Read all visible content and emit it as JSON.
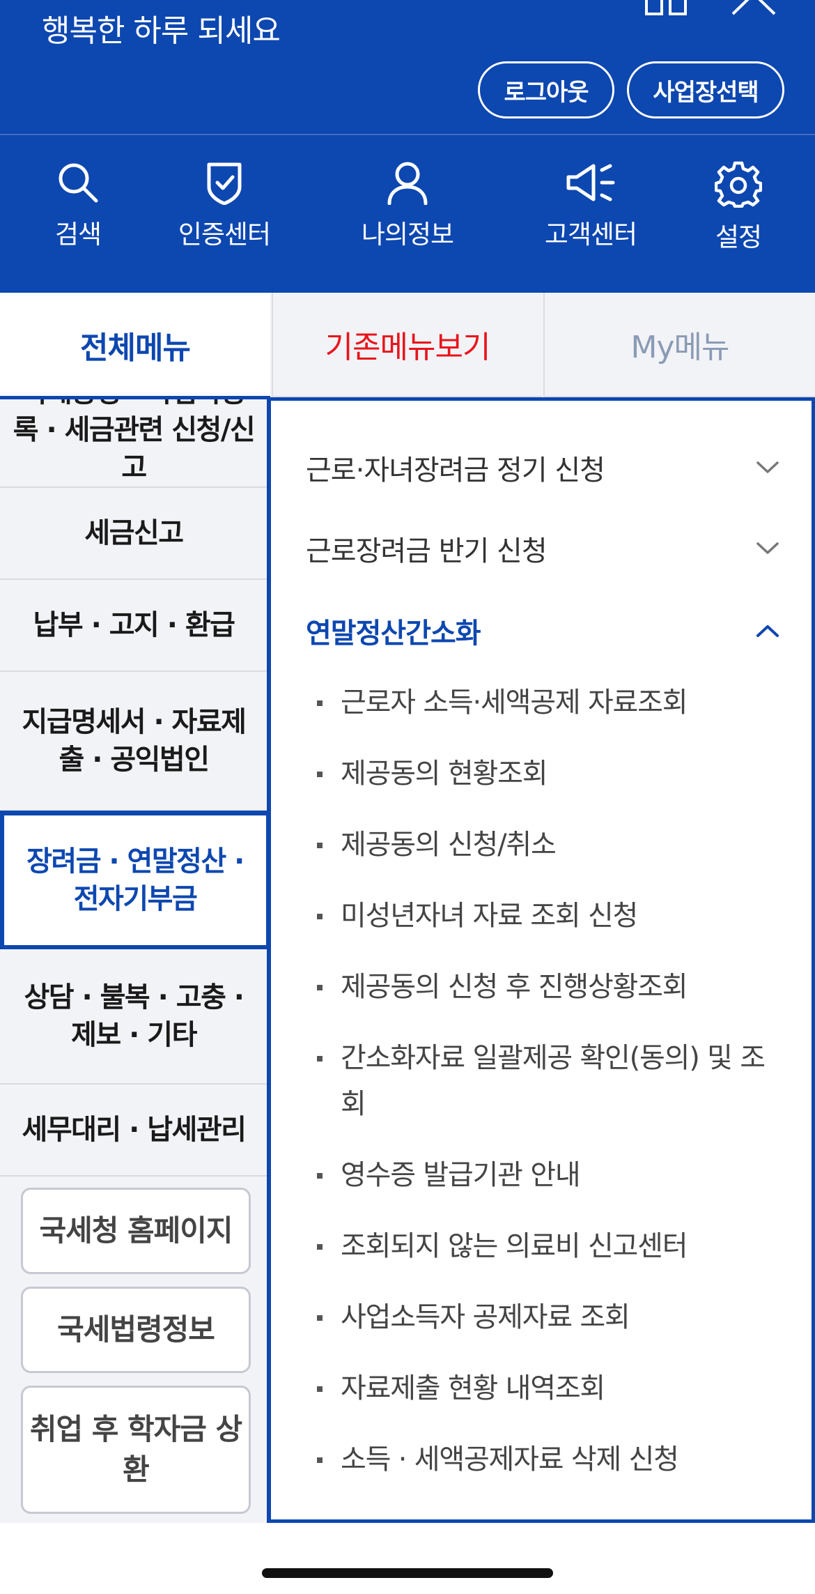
{
  "header": {
    "greeting": "행복한 하루 되세요",
    "logout_label": "로그아웃",
    "business_select_label": "사업장선택",
    "quick_nav": [
      {
        "icon": "search-icon",
        "label": "검색"
      },
      {
        "icon": "shield-check-icon",
        "label": "인증센터"
      },
      {
        "icon": "user-icon",
        "label": "나의정보"
      },
      {
        "icon": "megaphone-icon",
        "label": "고객센터"
      },
      {
        "icon": "gear-icon",
        "label": "설정"
      }
    ]
  },
  "tabs": {
    "all_menu": "전체메뉴",
    "legacy_menu": "기존메뉴보기",
    "my_menu": "My메뉴"
  },
  "left_menu": {
    "items": [
      "국세증명 · 사업자등록 · 세금관련 신청/신고",
      "세금신고",
      "납부 · 고지 · 환급",
      "지급명세서 · 자료제출 · 공익법인",
      "장려금 · 연말정산 · 전자기부금",
      "상담 · 불복 · 고충 · 제보 · 기타",
      "세무대리 · 납세관리"
    ],
    "buttons": [
      "국세청 홈페이지",
      "국세법령정보",
      "취업 후 학자금 상환"
    ]
  },
  "right_panel": {
    "sections": [
      {
        "title": "근로·자녀장려금 정기 신청",
        "expanded": false
      },
      {
        "title": "근로장려금 반기 신청",
        "expanded": false
      },
      {
        "title": "연말정산간소화",
        "expanded": true
      }
    ],
    "sub_items": [
      "근로자 소득·세액공제 자료조회",
      "제공동의 현황조회",
      "제공동의 신청/취소",
      "미성년자녀 자료 조회 신청",
      "제공동의 신청 후 진행상황조회",
      "간소화자료 일괄제공 확인(동의) 및 조회",
      "영수증 발급기관 안내",
      "조회되지 않는 의료비 신고센터",
      "사업소득자 공제자료 조회",
      "자료제출 현황 내역조회",
      "소득 · 세액공제자료 삭제 신청"
    ]
  },
  "colors": {
    "brand_blue": "#0d47b0",
    "legacy_red": "#e8141b",
    "my_menu_gray": "#8a9bb5"
  }
}
